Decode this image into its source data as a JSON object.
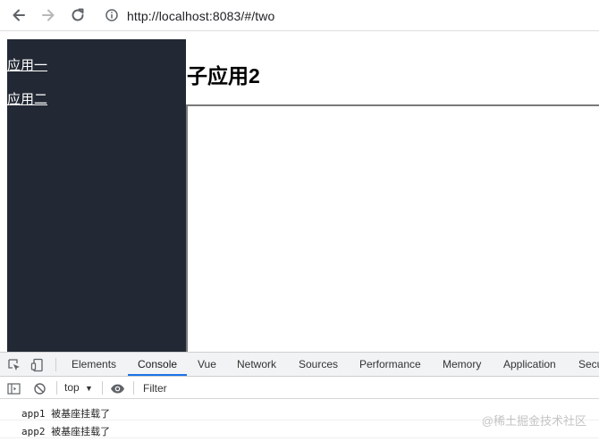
{
  "browser": {
    "url": "http://localhost:8083/#/two",
    "back_icon": "arrow-left-icon",
    "forward_icon": "arrow-right-icon",
    "reload_icon": "reload-icon",
    "info_icon": "info-icon"
  },
  "page": {
    "sidebar_links": [
      {
        "label": "应用一"
      },
      {
        "label": "应用二"
      }
    ],
    "main_title": "子应用2",
    "sidebar_color": "#222934"
  },
  "devtools": {
    "tabs": [
      {
        "label": "Elements"
      },
      {
        "label": "Console"
      },
      {
        "label": "Vue"
      },
      {
        "label": "Network"
      },
      {
        "label": "Sources"
      },
      {
        "label": "Performance"
      },
      {
        "label": "Memory"
      },
      {
        "label": "Application"
      },
      {
        "label": "Secu"
      }
    ],
    "active_tab": "Console",
    "accent_color": "#1a73e8",
    "context": "top",
    "filter_placeholder": "Filter",
    "logs": [
      "app1 被基座挂载了",
      "app2 被基座挂载了"
    ]
  },
  "watermark": "@稀土掘金技术社区"
}
